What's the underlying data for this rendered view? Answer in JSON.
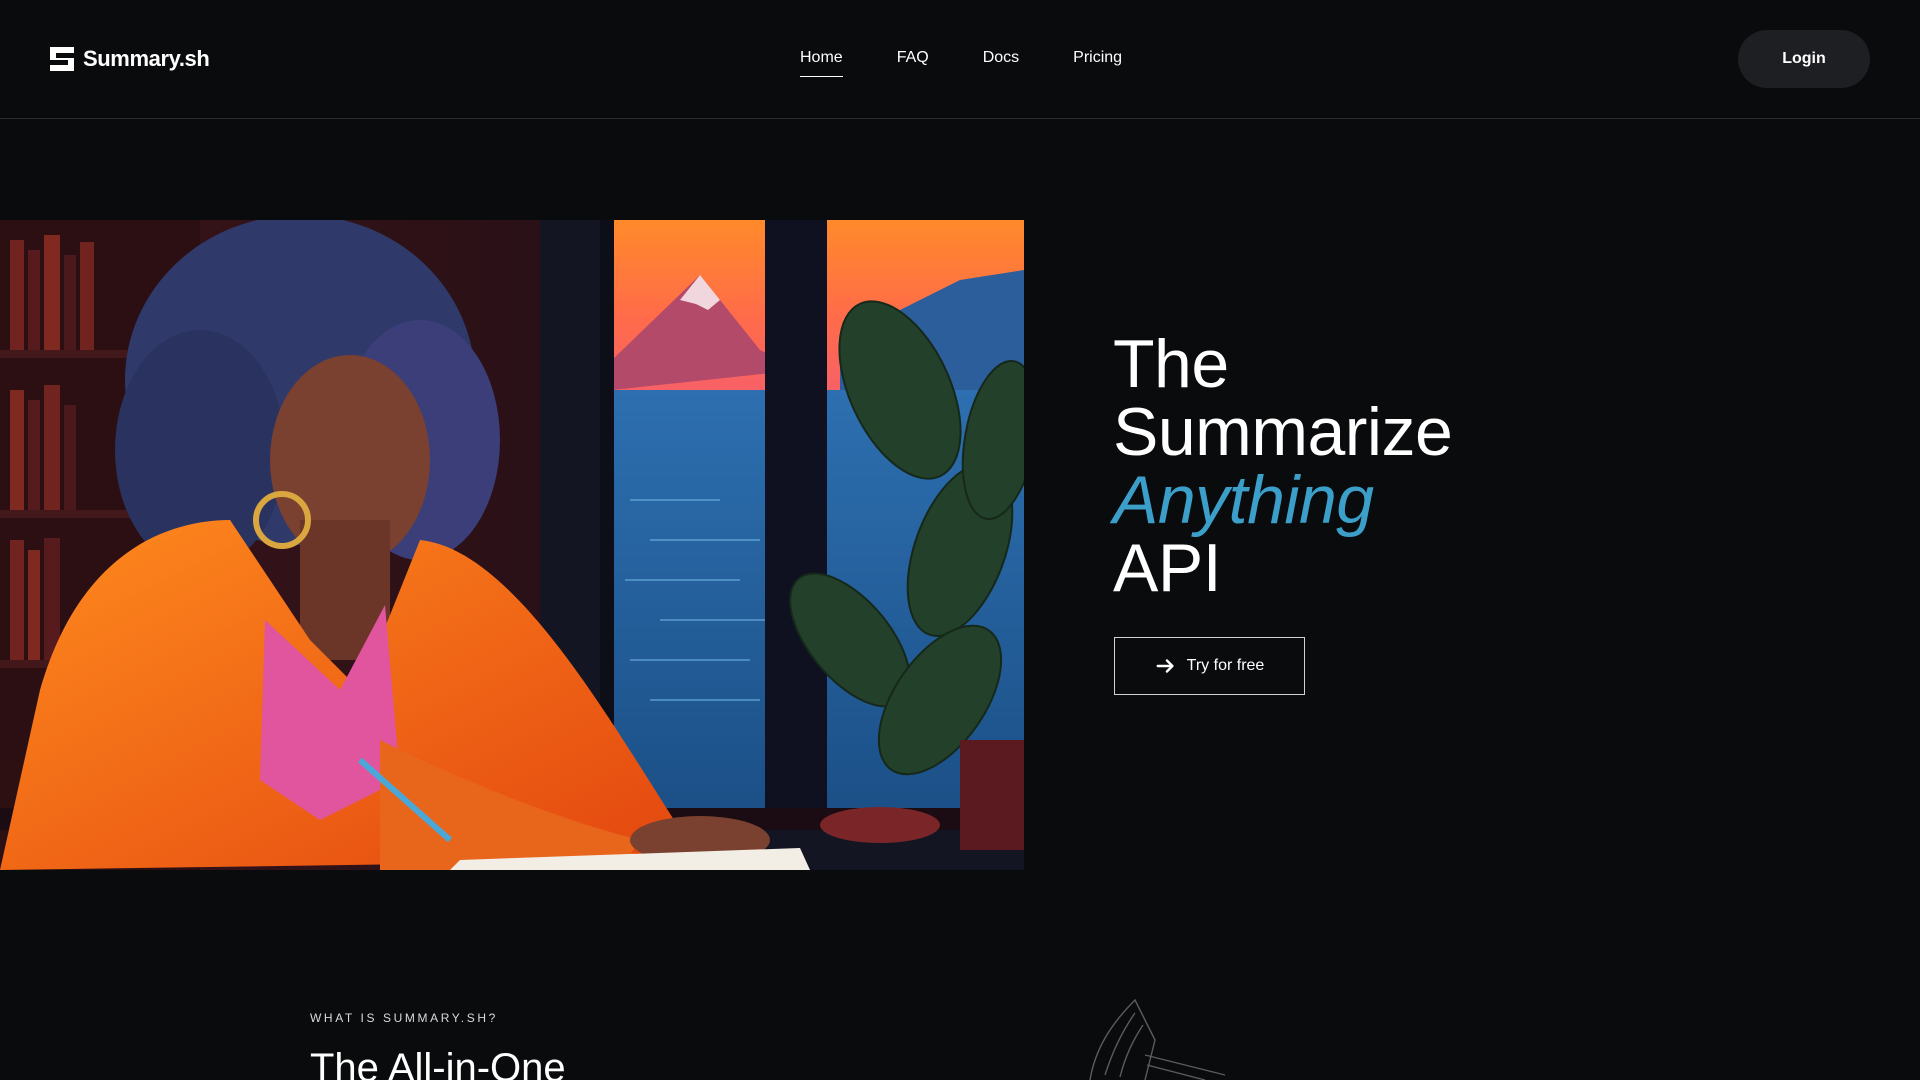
{
  "brand": {
    "name": "Summary.sh",
    "logo_icon": "summary-logo-icon"
  },
  "nav": {
    "items": [
      {
        "label": "Home",
        "active": true
      },
      {
        "label": "FAQ",
        "active": false
      },
      {
        "label": "Docs",
        "active": false
      },
      {
        "label": "Pricing",
        "active": false
      }
    ]
  },
  "header": {
    "login_label": "Login"
  },
  "hero": {
    "title_line1": "The",
    "title_line2": "Summarize",
    "title_accent": "Anything",
    "title_line4": "API",
    "cta_label": "Try for free",
    "cta_icon": "arrow-right-icon",
    "image": "illustration of a woman in an orange blazer writing at a desk by a window with mountain view",
    "accent_color": "#3b9fca"
  },
  "section": {
    "eyebrow": "WHAT IS SUMMARY.SH?",
    "title": "The All-in-One"
  },
  "colors": {
    "background": "#0a0b0d",
    "login_button_bg": "#1e1f23",
    "border": "#2a2c31"
  }
}
